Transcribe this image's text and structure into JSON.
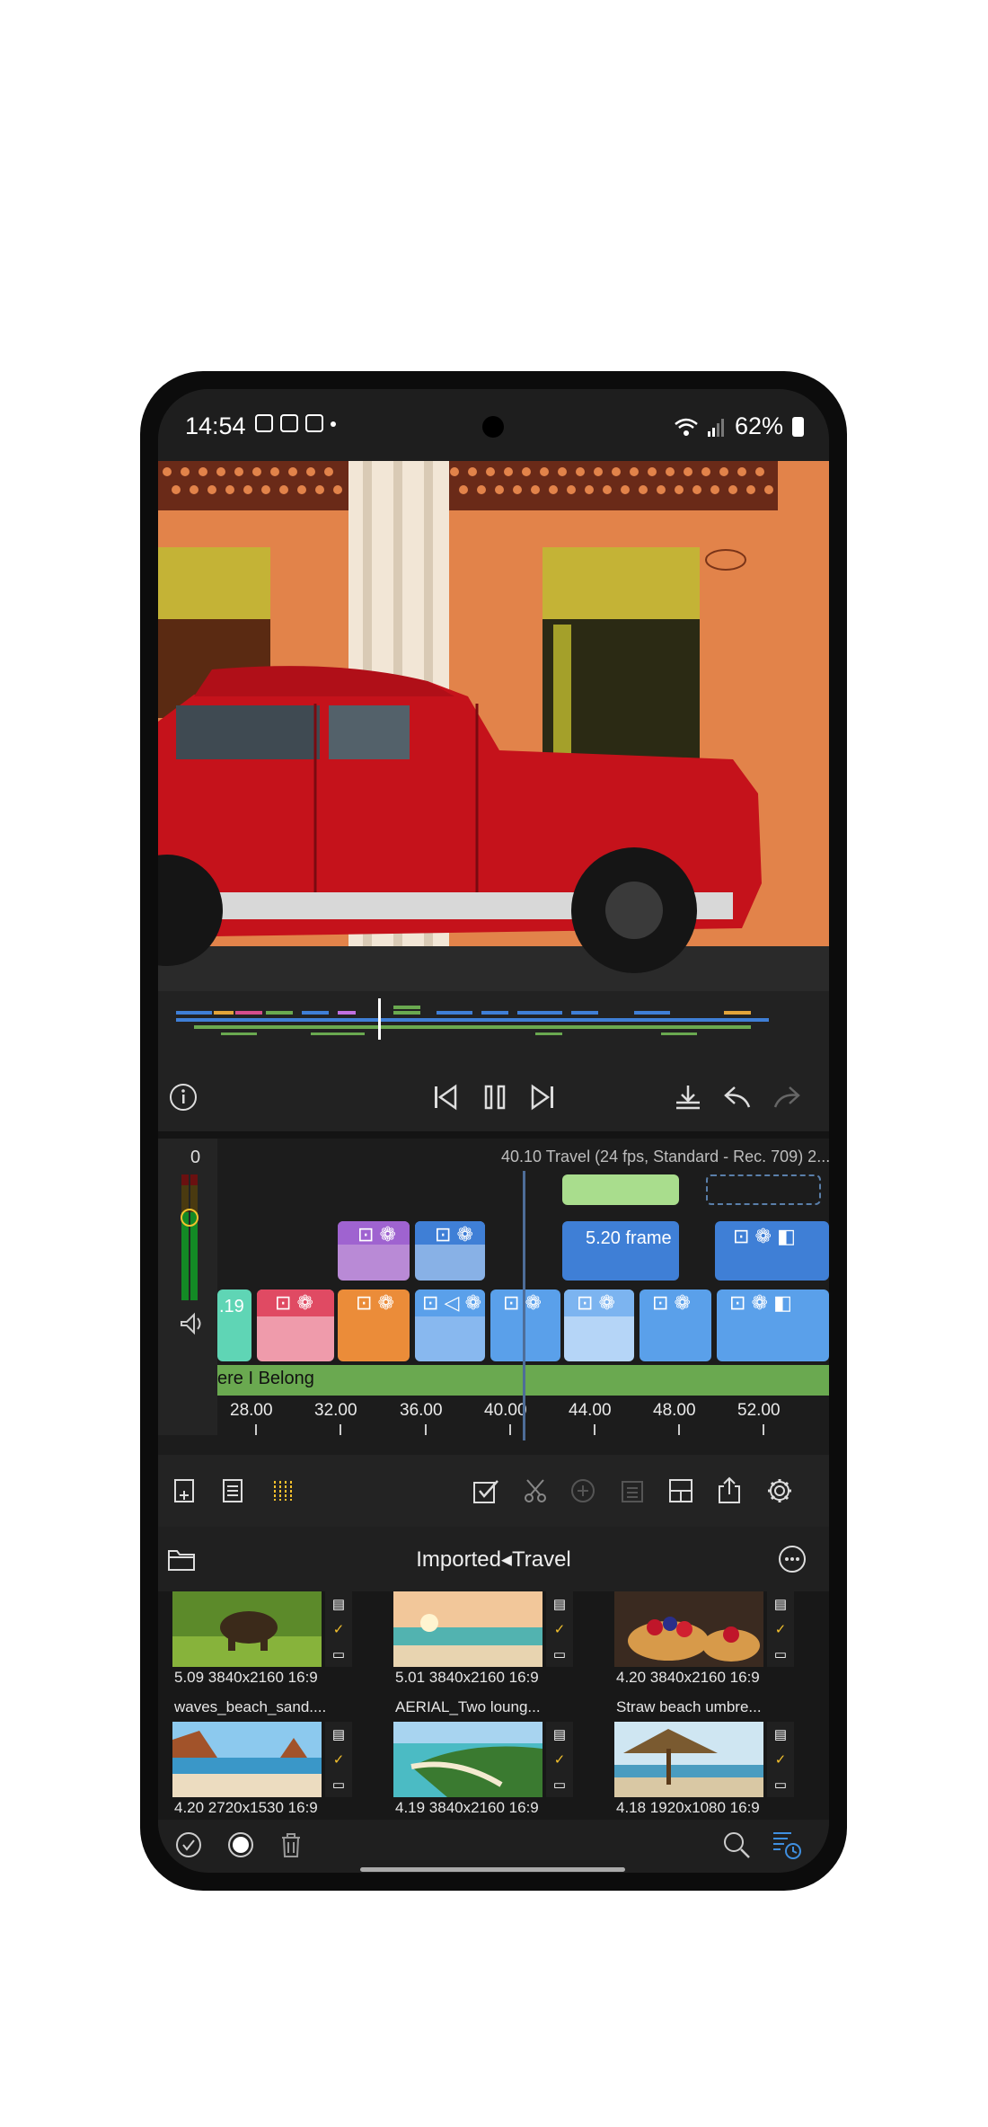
{
  "status_bar": {
    "time": "14:54",
    "battery": "62%"
  },
  "timeline": {
    "info": "40.10  Travel (24 fps, Standard - Rec. 709) 2...",
    "meter_value": "0",
    "clip_labels": {
      "left_clip": ".19",
      "title_clip": "5.20 frame"
    },
    "audio_label": "ere I Belong",
    "ruler": [
      "28.00",
      "32.00",
      "36.00",
      "40.00",
      "44.00",
      "48.00",
      "52.00"
    ]
  },
  "browser": {
    "title": "Imported◂Travel",
    "clips": [
      {
        "name": "",
        "meta": "5.09 3840x2160 16:9"
      },
      {
        "name": "",
        "meta": "5.01 3840x2160 16:9"
      },
      {
        "name": "",
        "meta": "4.20 3840x2160 16:9"
      },
      {
        "name": "waves_beach_sand....",
        "meta": "4.20 2720x1530 16:9"
      },
      {
        "name": "AERIAL_Two loung...",
        "meta": "4.19 3840x2160 16:9"
      },
      {
        "name": "Straw beach umbre...",
        "meta": "4.18 1920x1080 16:9"
      }
    ]
  },
  "colors": {
    "accent": "#f3c02d",
    "audio": "#6aa950",
    "clip_blue": "#3f7fd6"
  }
}
